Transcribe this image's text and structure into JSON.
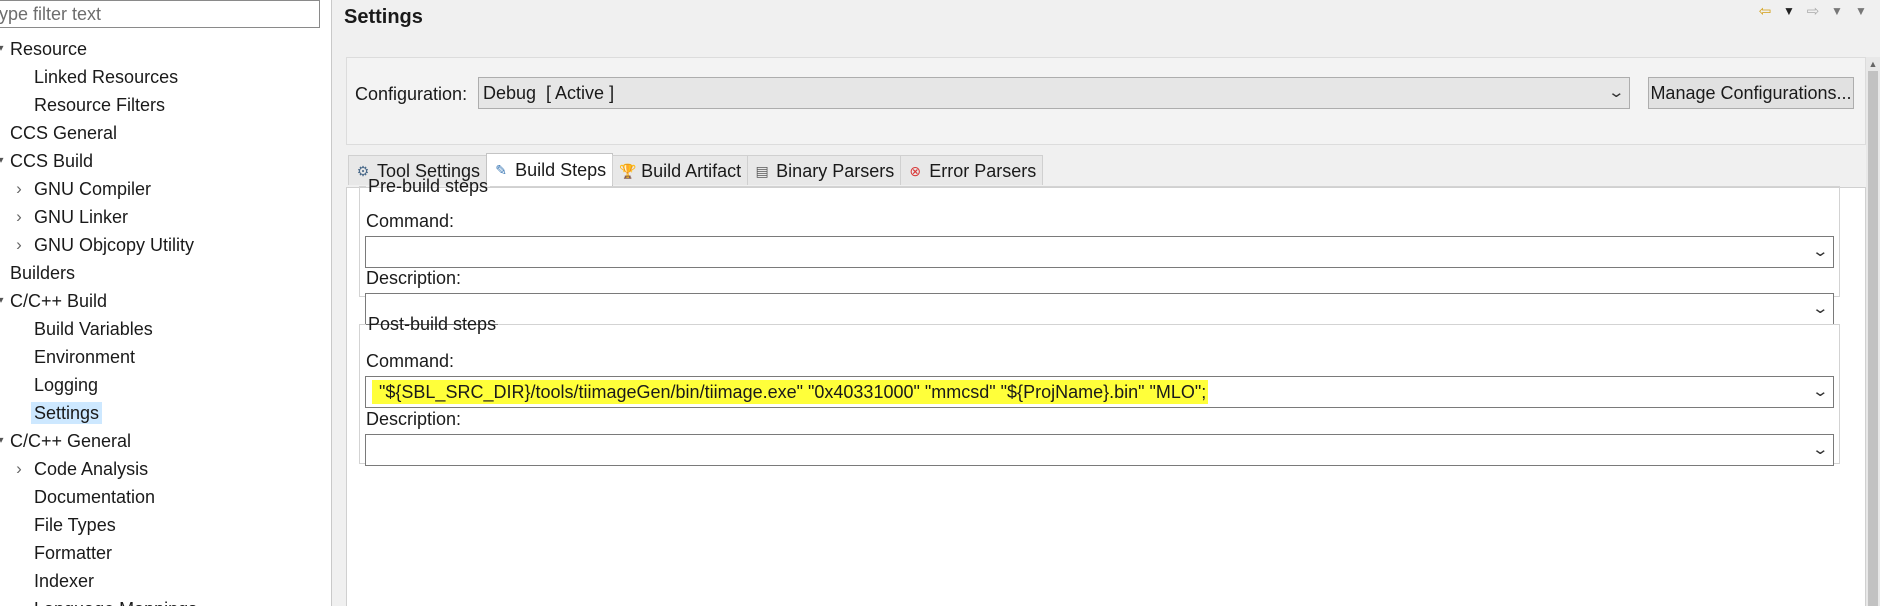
{
  "filter": {
    "placeholder": "ype filter text"
  },
  "tree": [
    {
      "label": "Resource",
      "level": 0,
      "arrow": "▾"
    },
    {
      "label": "Linked Resources",
      "level": 1,
      "arrow": ""
    },
    {
      "label": "Resource Filters",
      "level": 1,
      "arrow": ""
    },
    {
      "label": "CCS General",
      "level": 0,
      "arrow": ""
    },
    {
      "label": "CCS Build",
      "level": 0,
      "arrow": "▾"
    },
    {
      "label": "GNU Compiler",
      "level": 1,
      "arrow": "›"
    },
    {
      "label": "GNU Linker",
      "level": 1,
      "arrow": "›"
    },
    {
      "label": "GNU Objcopy Utility",
      "level": 1,
      "arrow": "›"
    },
    {
      "label": "Builders",
      "level": 0,
      "arrow": ""
    },
    {
      "label": "C/C++ Build",
      "level": 0,
      "arrow": "▾"
    },
    {
      "label": "Build Variables",
      "level": 1,
      "arrow": ""
    },
    {
      "label": "Environment",
      "level": 1,
      "arrow": ""
    },
    {
      "label": "Logging",
      "level": 1,
      "arrow": ""
    },
    {
      "label": "Settings",
      "level": 1,
      "arrow": "",
      "selected": true
    },
    {
      "label": "C/C++ General",
      "level": 0,
      "arrow": "▾"
    },
    {
      "label": "Code Analysis",
      "level": 1,
      "arrow": "›"
    },
    {
      "label": "Documentation",
      "level": 1,
      "arrow": ""
    },
    {
      "label": "File Types",
      "level": 1,
      "arrow": ""
    },
    {
      "label": "Formatter",
      "level": 1,
      "arrow": ""
    },
    {
      "label": "Indexer",
      "level": 1,
      "arrow": ""
    },
    {
      "label": "Language Mappings",
      "level": 1,
      "arrow": ""
    }
  ],
  "header": {
    "title": "Settings"
  },
  "config": {
    "label": "Configuration:",
    "value": "Debug  [ Active ]",
    "manage_label": "Manage Configurations..."
  },
  "tabs": [
    {
      "label": "Tool Settings",
      "icon": "tool-settings-icon",
      "glyph": "⚙",
      "color": "#4a6a8a",
      "active": false
    },
    {
      "label": "Build Steps",
      "icon": "build-steps-icon",
      "glyph": "✎",
      "color": "#3a78b5",
      "active": true
    },
    {
      "label": "Build Artifact",
      "icon": "build-artifact-icon",
      "glyph": "🏆",
      "color": "#d4a017",
      "active": false
    },
    {
      "label": "Binary Parsers",
      "icon": "binary-parsers-icon",
      "glyph": "▤",
      "color": "#5a5a5a",
      "active": false
    },
    {
      "label": "Error Parsers",
      "icon": "error-parsers-icon",
      "glyph": "⊗",
      "color": "#d93636",
      "active": false
    }
  ],
  "pre_build": {
    "legend": "Pre-build steps",
    "command_label": "Command:",
    "command_value": "",
    "description_label": "Description:",
    "description_value": ""
  },
  "post_build": {
    "legend": "Post-build steps",
    "command_label": "Command:",
    "command_value": " \"${SBL_SRC_DIR}/tools/tiimageGen/bin/tiimage.exe\" \"0x40331000\" \"mmcsd\" \"${ProjName}.bin\" \"MLO\";",
    "description_label": "Description:",
    "description_value": ""
  },
  "colors": {
    "highlight": "#ffff3a",
    "selection": "#cde8ff"
  }
}
